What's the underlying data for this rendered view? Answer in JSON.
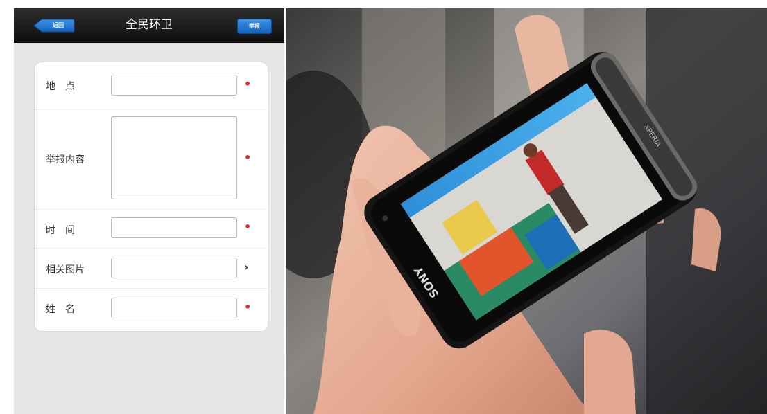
{
  "navbar": {
    "back_label": "返回",
    "title": "全民环卫",
    "report_label": "举报"
  },
  "form": {
    "rows": [
      {
        "label": "地　点",
        "marker": "•"
      },
      {
        "label": "举报内容",
        "marker": "•"
      },
      {
        "label": "时　间",
        "marker": "•"
      },
      {
        "label": "相关图片",
        "marker": "›"
      },
      {
        "label": "姓　名",
        "marker": "•"
      }
    ]
  },
  "photo": {
    "phone_brand": "SONY",
    "phone_model": "XPERIA"
  },
  "colors": {
    "navbar": "#1a1a1a",
    "accent": "#1f6fd0",
    "required": "#e0261b",
    "background": "#e6e6e6"
  }
}
